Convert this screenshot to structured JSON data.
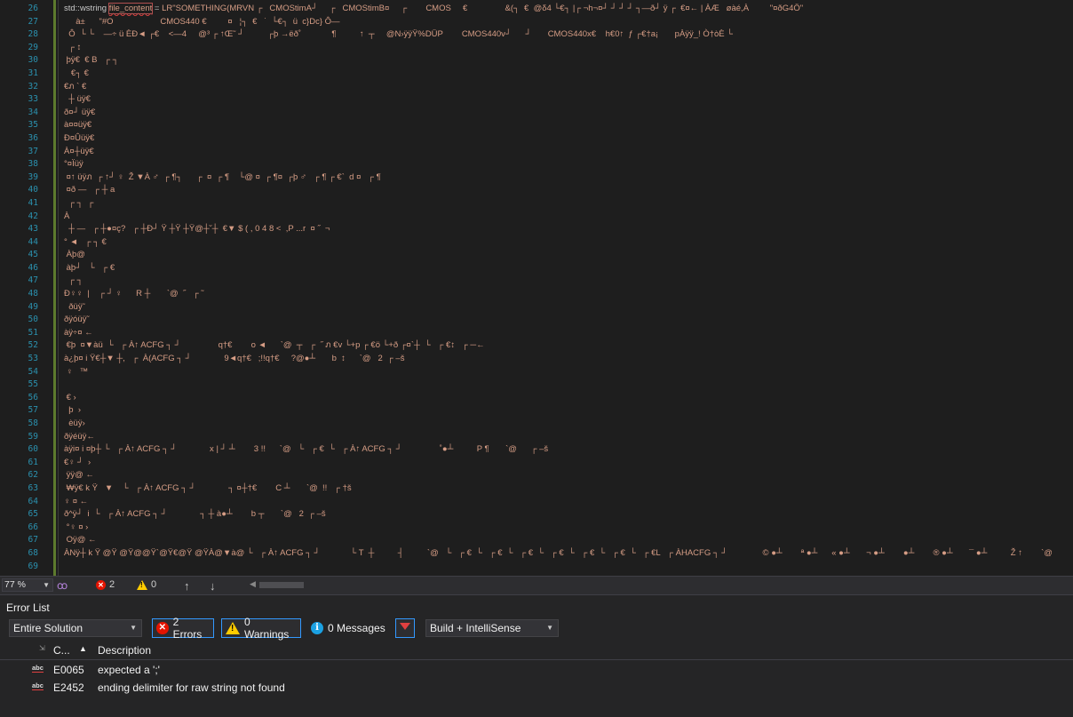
{
  "editor": {
    "line_numbers": [
      "26",
      "27",
      "28",
      "29",
      "30",
      "31",
      "32",
      "33",
      "34",
      "35",
      "36",
      "37",
      "38",
      "39",
      "40",
      "41",
      "42",
      "43",
      "44",
      "45",
      "46",
      "47",
      "48",
      "49",
      "50",
      "51",
      "52",
      "53",
      "54",
      "55",
      "56",
      "57",
      "58",
      "59",
      "60",
      "61",
      "62",
      "63",
      "64",
      "65",
      "66",
      "67",
      "68",
      "69"
    ],
    "first_line": {
      "type": "std::wstring",
      "variable": "file_content",
      "op": "=",
      "rest": "LR\"SOMETHING(MRVN ┌   CMOStimA┘     ┌   CMOStimB¤     ┌        CMOS     €                &(┐  €  @δ4 └€┐ |┌ ¬h¬¤┘ ┘ ┘ ┘ ┐—ð┘ ÿ ┌  €¤← | ÀÆ   øàé,À         \"¤ðG4Ö\""
    },
    "lines": [
      "     à±      \"#O                    CMOS440 €         ¤   ¦┐  €   ˙  └€┐  ü  c}Dc} Ô—",
      "  Ô  └ └    —÷ ü ÈÐ◄ ┌€    <—4     @³ ┌ ↑Œ˜ ┘          ┌þ →ëð˚             ¶          ↑  ┬     @N›ÿÿŸ%DÜP        CMOS440v┘      ┘       CMOS440x€    h€0↑  ƒ ┌€†a¡       pÀÿÿ_! Ò†òÈ └",
      "  ┌ ↕",
      " þÿ€  € B   ┌ ┐",
      "   €┐ €",
      "€ภ ` €",
      "  ┼ üÿ€",
      "ð¤┘ üÿ€",
      "à¤¤üÿ€",
      "Ð¤Ûüÿ€",
      "À¤┼üÿ€",
      "°¤Ïüÿ",
      " ¤↑ üÿภ  ┌ ↑┘ ♀  Ž ▼À ♂  ┌ ¶┐      ┌  ¤  ┌ ¶    └@ ¤  ┌ ¶¤  ┌þ ♂   ┌ ¶ ┌ €`  d ¤   ┌ ¶",
      " ¤ð —   ┌ ┼ a",
      "  ┌ ┐  ┌",
      "À",
      "  ┼ —   ┌ ┼●¤ç?   ┌ ┼Ð┘ Ÿ ┼Ÿ ┼Ÿ@┼˘┼  €▼ $ ( , 0 4 8 <  ,P ...r  ¤ ˝  ¬",
      "° ◄   ┌ ┐ €",
      " Àþ@",
      " àþ┘   └   ┌ €",
      "  ┌ ┐",
      "Ð♀♀  |    ┌ ┘ ♀      R ┼       `@  ˝   ┌ ˜",
      "  ðüÿ˜",
      "ðÿóüÿ˜",
      "àÿ÷¤ ←",
      " €þ  ¤▼àü  └   ┌ À↑ ACFG ┐ ┘                q†€        o ◄      `@  ┬   ┌  ˝ ภ €v └+p ┌ €ö └+ð ┌¤`┼  └   ┌ €↕   ┌ ─←",
      "à¿þ¤ i Ÿ€┼▼ ┼,   ┌  À(ACFG ┐ ┘              9◄q†€   ;!!q†€     ?@●┴       b  ↕      `@   2  ┌ –š",
      " ♀   ™",
      "",
      " € ›",
      "  þ  ›",
      "  èüÿ›",
      "ðÿéüÿ←",
      "àÿi¤ i ¤þ┼ └   ┌ À↑ ACFG ┐ ┘              x | ┘ ┴        3 !!      `@   └   ┌ €  └   ┌ À↑ ACFG ┐ ┘                ˚●┴          P ¶       `@      ┌ –š",
      "€♀ ┘  ›",
      " ÿÿ@ ←",
      " ₩ÿ€ k Ÿ   ▼    └   ┌ À↑ ACFG ┐ ┘              ┐ ¤┼†€        C ┴       `@  !!   ┌ †š",
      "♀ ¤ ←",
      "ð^ÿ┘  i  └   ┌ À↑ ACFG ┐ ┘              ┐ ┼ à●┴        b ┬       `@   2  ┌ –š",
      " °♀ ¤ ›",
      " Oÿ@ ←",
      "ÀNÿ┼ k Ÿ @Ÿ @Ÿ@@Ÿ`@Ÿ€@Ÿ @ŸÀ@▼à@ └   ┌ À↑ ACFG ┐ ┘             └ T  ┼          ┤          `@   └   ┌ €  └   ┌ €  └   ┌ €  └   ┌ €  └   ┌ €  └   ┌ €  └   ┌ €L   ┌ ÀHACFG ┐ ┘               © ●┴        ª ●┴      « ●┴       ¬ ●┴        ●┴        ® ●┴       ¯ ●┴          Ž ↑        `@",
      ""
    ]
  },
  "editor_status": {
    "zoom": "77 %",
    "error_count": "2",
    "warning_count": "0"
  },
  "error_list": {
    "title": "Error List",
    "scope": "Entire Solution",
    "errors_label": "2 Errors",
    "warnings_label": "0 Warnings",
    "messages_label": "0 Messages",
    "source_filter": "Build + IntelliSense",
    "col_code": "C...",
    "col_description": "Description",
    "rows": [
      {
        "icon": "abc",
        "code": "E0065",
        "description": "expected a ';'"
      },
      {
        "icon": "abc",
        "code": "E2452",
        "description": "ending delimiter for raw string not found"
      }
    ]
  }
}
